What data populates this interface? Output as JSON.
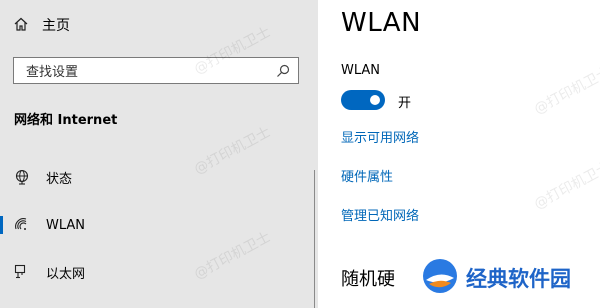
{
  "sidebar": {
    "home_label": "主页",
    "search_placeholder": "查找设置",
    "section_title": "网络和 Internet",
    "items": [
      {
        "label": "状态",
        "icon": "globe-icon"
      },
      {
        "label": "WLAN",
        "icon": "wifi-icon",
        "active": true
      },
      {
        "label": "以太网",
        "icon": "ethernet-icon"
      }
    ]
  },
  "main": {
    "title": "WLAN",
    "wlan_label": "WLAN",
    "toggle_state": "开",
    "links": [
      "显示可用网络",
      "硬件属性",
      "管理已知网络"
    ],
    "section_heading": "随机硬"
  },
  "watermark": "@打印机卫士",
  "badge": {
    "text": "经典软件园"
  },
  "colors": {
    "accent": "#0067c0",
    "link": "#0067b8",
    "sidebar_bg": "#e6e6e6",
    "badge_text": "#1e64c8"
  }
}
